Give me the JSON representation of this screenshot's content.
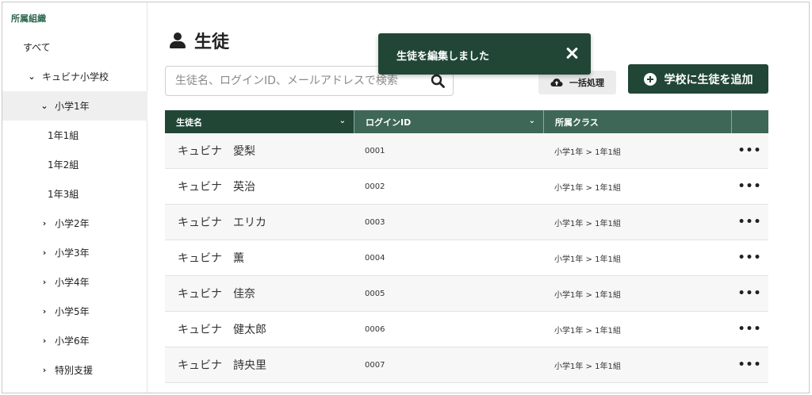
{
  "sidebar": {
    "title": "所属組織",
    "items": [
      {
        "label": "すべて",
        "chevron": "",
        "indent": 0
      },
      {
        "label": "キュビナ小学校",
        "chevron": "⌄",
        "indent": 1
      },
      {
        "label": "小学1年",
        "chevron": "⌄",
        "indent": 2,
        "active": true
      },
      {
        "label": "1年1組",
        "chevron": "",
        "indent": 3
      },
      {
        "label": "1年2組",
        "chevron": "",
        "indent": 3
      },
      {
        "label": "1年3組",
        "chevron": "",
        "indent": 3
      },
      {
        "label": "小学2年",
        "chevron": "›",
        "indent": 2
      },
      {
        "label": "小学3年",
        "chevron": "›",
        "indent": 2
      },
      {
        "label": "小学4年",
        "chevron": "›",
        "indent": 2
      },
      {
        "label": "小学5年",
        "chevron": "›",
        "indent": 2
      },
      {
        "label": "小学6年",
        "chevron": "›",
        "indent": 2
      },
      {
        "label": "特別支援",
        "chevron": "›",
        "indent": 2
      }
    ]
  },
  "header": {
    "title": "生徒"
  },
  "search": {
    "placeholder": "生徒名、ログインID、メールアドレスで検索",
    "value": ""
  },
  "toolbar": {
    "bulk_label": "一括処理",
    "add_label": "学校に生徒を追加"
  },
  "table": {
    "columns": [
      "生徒名",
      "ログインID",
      "所属クラス",
      ""
    ],
    "rows": [
      {
        "name": "キュビナ　愛梨",
        "login_id": "0001",
        "class": "小学1年 > 1年1組"
      },
      {
        "name": "キュビナ　英治",
        "login_id": "0002",
        "class": "小学1年 > 1年1組"
      },
      {
        "name": "キュビナ　エリカ",
        "login_id": "0003",
        "class": "小学1年 > 1年1組"
      },
      {
        "name": "キュビナ　薫",
        "login_id": "0004",
        "class": "小学1年 > 1年1組"
      },
      {
        "name": "キュビナ　佳奈",
        "login_id": "0005",
        "class": "小学1年 > 1年1組"
      },
      {
        "name": "キュビナ　健太郎",
        "login_id": "0006",
        "class": "小学1年 > 1年1組"
      },
      {
        "name": "キュビナ　詩央里",
        "login_id": "0007",
        "class": "小学1年 > 1年1組"
      }
    ],
    "row_menu": "•••"
  },
  "toast": {
    "message": "生徒を編集しました"
  },
  "colors": {
    "primary": "#214636",
    "header_bg": "#3e6757",
    "sidebar_title": "#2f6650"
  },
  "icons": {
    "title": "person-icon",
    "search": "search-icon",
    "bulk": "cloud-upload-icon",
    "add": "plus-circle-icon",
    "close": "close-icon",
    "row_menu": "more-horizontal-icon"
  }
}
